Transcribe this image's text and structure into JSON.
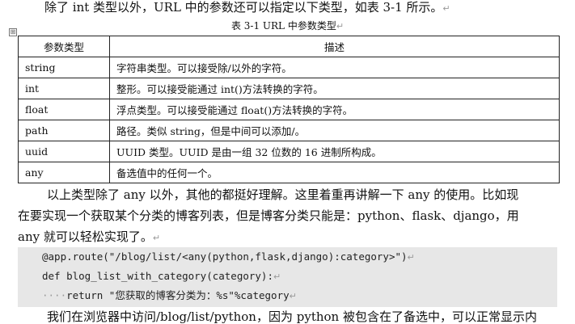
{
  "intro": {
    "text": "除了 int 类型以外，URL 中的参数还可以指定以下类型，如表 3-1 所示。",
    "mark": "↵"
  },
  "table": {
    "caption": "表 3-1 URL 中参数类型",
    "caption_mark": "↵",
    "handle_symbol": "⊞",
    "headers": [
      "参数类型",
      "描述"
    ],
    "rows": [
      {
        "type": "string",
        "desc": "字符串类型。可以接受除/以外的字符。"
      },
      {
        "type": "int",
        "desc": "整形。可以接受能通过 int()方法转换的字符。"
      },
      {
        "type": "float",
        "desc": "浮点类型。可以接受能通过 float()方法转换的字符。"
      },
      {
        "type": "path",
        "desc": "路径。类似 string，但是中间可以添加/。"
      },
      {
        "type": "uuid",
        "desc": "UUID 类型。UUID 是由一组 32 位数的 16 进制所构成。"
      },
      {
        "type": "any",
        "desc": "备选值中的任何一个。"
      }
    ]
  },
  "paragraph2": {
    "line1": "以上类型除了 any 以外，其他的都挺好理解。这里着重再讲解一下 any 的使用。比如现",
    "line2": "在要实现一个获取某个分类的博客列表，但是博客分类只能是：python、flask、django，用",
    "line3": "any 就可以轻松实现了。"
  },
  "code": {
    "line1": "@app.route(\"/blog/list/<any(python,flask,django):category>\")",
    "line2": "def blog_list_with_category(category):",
    "line3_indent": "····",
    "line3": "return \"您获取的博客分类为：%s\"%category"
  },
  "paragraph3": {
    "line1": "我们在浏览器中访问/blog/list/python，因为 python 被包含在了备选中，可以正常显示内"
  }
}
